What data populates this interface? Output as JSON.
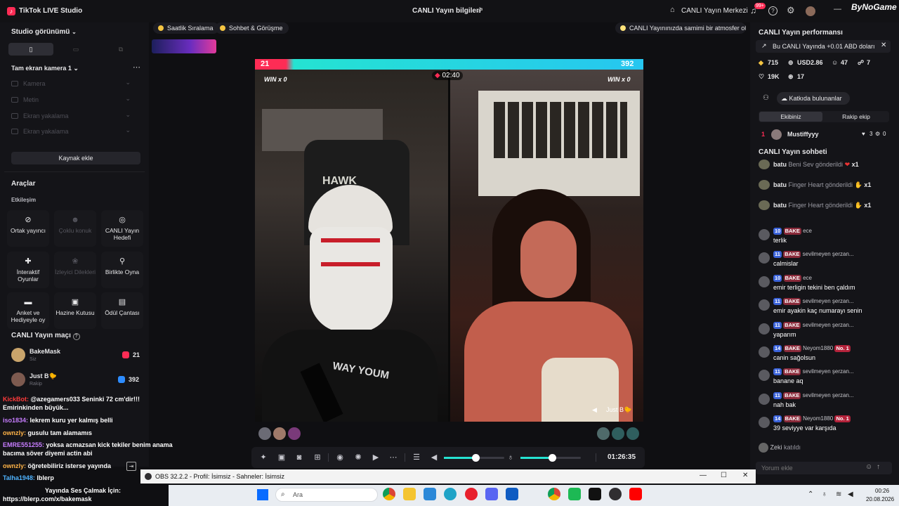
{
  "app": {
    "title": "TikTok LIVE Studio",
    "window_title": "CANLI Yayın bilgileri",
    "live_center": "CANLI Yayın Merkezi",
    "notif_badge": "99+",
    "watermark": "ByNoGame"
  },
  "left": {
    "studio_view": "Studio görünümü",
    "scene": "Tam ekran kamera 1",
    "sources": [
      "Kamera",
      "Metin",
      "Ekran yakalama",
      "Ekran yakalama"
    ],
    "add_source": "Kaynak ekle",
    "tools_title": "Araçlar",
    "interaction": "Etkileşim",
    "tools": [
      "Ortak yayıncı",
      "Çoklu konuk",
      "CANLI Yayın Hedefi",
      "İnteraktif Oyunlar",
      "İzleyici Dilekleri",
      "Birlikte Oyna",
      "Anket ve Hediyeyle oy",
      "Hazine Kutusu",
      "Ödül Çantası"
    ],
    "match_title": "CANLI Yayın maçı",
    "match": [
      {
        "name": "BakeMask",
        "sub": "Siz",
        "score": "21"
      },
      {
        "name": "Just B🐤",
        "sub": "Rakip",
        "score": "392"
      }
    ]
  },
  "overlay_chat": [
    {
      "user": "KickBot:",
      "text": " @azegamers033 Seninki 72 cm'dir!!!",
      "color": "#ff3b3b"
    },
    {
      "user": "",
      "text": "Emirinkinden büyük...",
      "color": "#ffffff"
    },
    {
      "user": "iso1834:",
      "text": " lekrem kuru yer kalmış belli",
      "color": "#c77dff"
    },
    {
      "user": "ownzly:",
      "text": " gusulu tam alamamıs",
      "color": "#ffb347"
    },
    {
      "user": "EMRE551255:",
      "text": " yoksa acmazsan kick tekiler benim anama",
      "color": "#c77dff"
    },
    {
      "user": "",
      "text": "bacıma söver diyemi actin abi",
      "color": "#ffffff"
    },
    {
      "user": "ownzly:",
      "text": " öğretebiliriz isterse yayında",
      "color": "#ffb347"
    },
    {
      "user": "Talha1948:",
      "text": " lblerp",
      "color": "#4fb3ff"
    },
    {
      "user": "",
      "text": "Yayında Ses Çalmak İçin:",
      "color": "#ffffff"
    },
    {
      "user": "",
      "text": "https://blerp.com/x/bakemask",
      "color": "#ffffff"
    }
  ],
  "center": {
    "chips": [
      "Saatlik Sıralama",
      "Sohbet & Görüşme"
    ],
    "notice": "CANLI Yayınınızda samimi bir atmosfer olu...",
    "score_left": "21",
    "score_right": "392",
    "win_left": "WIN x 0",
    "win_right": "WIN x 0",
    "timer": "02:40",
    "guest_name": "Just B🐤",
    "mask_text": "HAWK",
    "shirt_text": "WAY YOUM",
    "elapsed": "01:26:35"
  },
  "right": {
    "perf_title": "CANLI Yayın performansı",
    "perf_note": "Bu CANLI Yayında +0.01 ABD doları",
    "stats": [
      "715",
      "USD2.86",
      "47",
      "7",
      "19K",
      "17"
    ],
    "contributors": "Katkıda bulunanlar",
    "tab_ours": "Ekibiniz",
    "tab_rival": "Rakip ekip",
    "top_rank": "1",
    "top_user": "Mustiffyyy",
    "top_a": "3",
    "top_b": "0",
    "chat_title": "CANLI Yayın sohbeti",
    "gifts": [
      {
        "user": "batu",
        "text": " Beni Sev gönderildi",
        "count": "x1"
      },
      {
        "user": "batu",
        "text": " Finger Heart gönderildi",
        "count": "x1"
      },
      {
        "user": "batu",
        "text": " Finger Heart gönderildi",
        "count": "x1"
      }
    ],
    "chats": [
      {
        "lvl": "10",
        "name": "ece",
        "msg": "terlik"
      },
      {
        "lvl": "11",
        "name": "sevilmeyen şerzan...",
        "msg": "calmislar"
      },
      {
        "lvl": "10",
        "name": "ece",
        "msg": "emir terligin tekini ben çaldım"
      },
      {
        "lvl": "11",
        "name": "sevilmeyen şerzan...",
        "msg": "emir ayakin kaç numarayı senin"
      },
      {
        "lvl": "11",
        "name": "sevilmeyen şerzan...",
        "msg": "yaparım"
      },
      {
        "lvl": "14",
        "name": "Neyom1880",
        "msg": "canin sağolsun",
        "no1": "No. 1"
      },
      {
        "lvl": "11",
        "name": "sevilmeyen şerzan...",
        "msg": "banane aq"
      },
      {
        "lvl": "11",
        "name": "sevilmeyen şerzan...",
        "msg": "nah bak"
      },
      {
        "lvl": "14",
        "name": "Neyom1880",
        "msg": "39 seviyye var karşıda",
        "no1": "No. 1"
      }
    ],
    "bake": "BAKE",
    "joined_user": "Zeki",
    "joined_text": "katıldı",
    "comment_placeholder": "Yorum ekle"
  },
  "obs_bar": "OBS 32.2.2 - Profil: İsimsiz - Sahneler: İsimsiz",
  "taskbar": {
    "search": "Ara",
    "time": "00:26",
    "date": "20.08.2026"
  }
}
